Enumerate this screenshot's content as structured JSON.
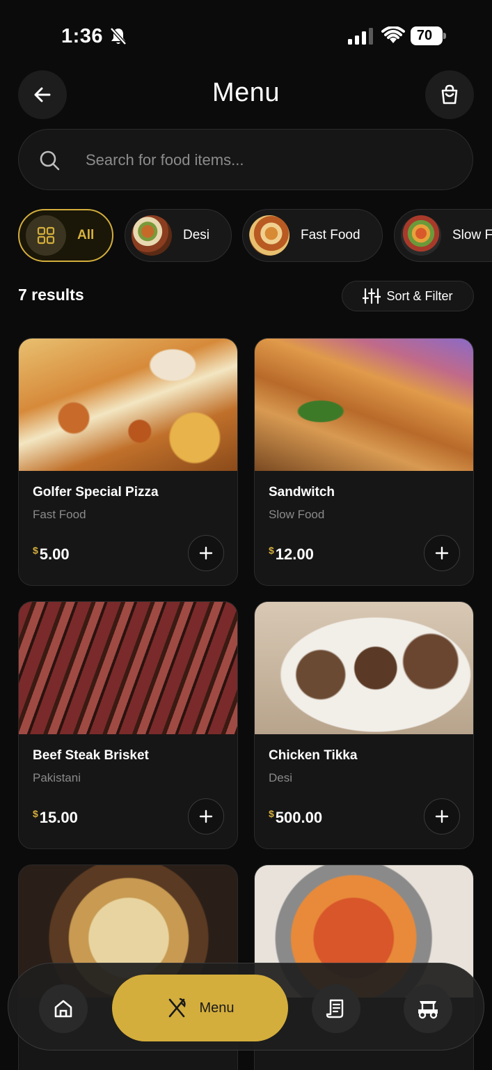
{
  "status_bar": {
    "time": "1:36",
    "battery": "70"
  },
  "header": {
    "title": "Menu"
  },
  "search": {
    "placeholder": "Search for food items..."
  },
  "categories": [
    {
      "label": "All",
      "active": true,
      "icon": "grid-icon"
    },
    {
      "label": "Desi",
      "active": false
    },
    {
      "label": "Fast Food",
      "active": false
    },
    {
      "label": "Slow Fo",
      "active": false
    }
  ],
  "results": {
    "count_label": "7 results",
    "sort_label": "Sort & Filter"
  },
  "products": [
    {
      "name": "Golfer Special Pizza",
      "category": "Fast Food",
      "currency": "$",
      "price": "5.00"
    },
    {
      "name": "Sandwitch",
      "category": "Slow Food",
      "currency": "$",
      "price": "12.00"
    },
    {
      "name": "Beef Steak Brisket",
      "category": "Pakistani",
      "currency": "$",
      "price": "15.00"
    },
    {
      "name": "Chicken Tikka",
      "category": "Desi",
      "currency": "$",
      "price": "500.00"
    }
  ],
  "bottom_nav": {
    "menu_label": "Menu"
  },
  "colors": {
    "accent": "#d4ae3c",
    "background": "#0b0b0b",
    "card": "#161616"
  }
}
